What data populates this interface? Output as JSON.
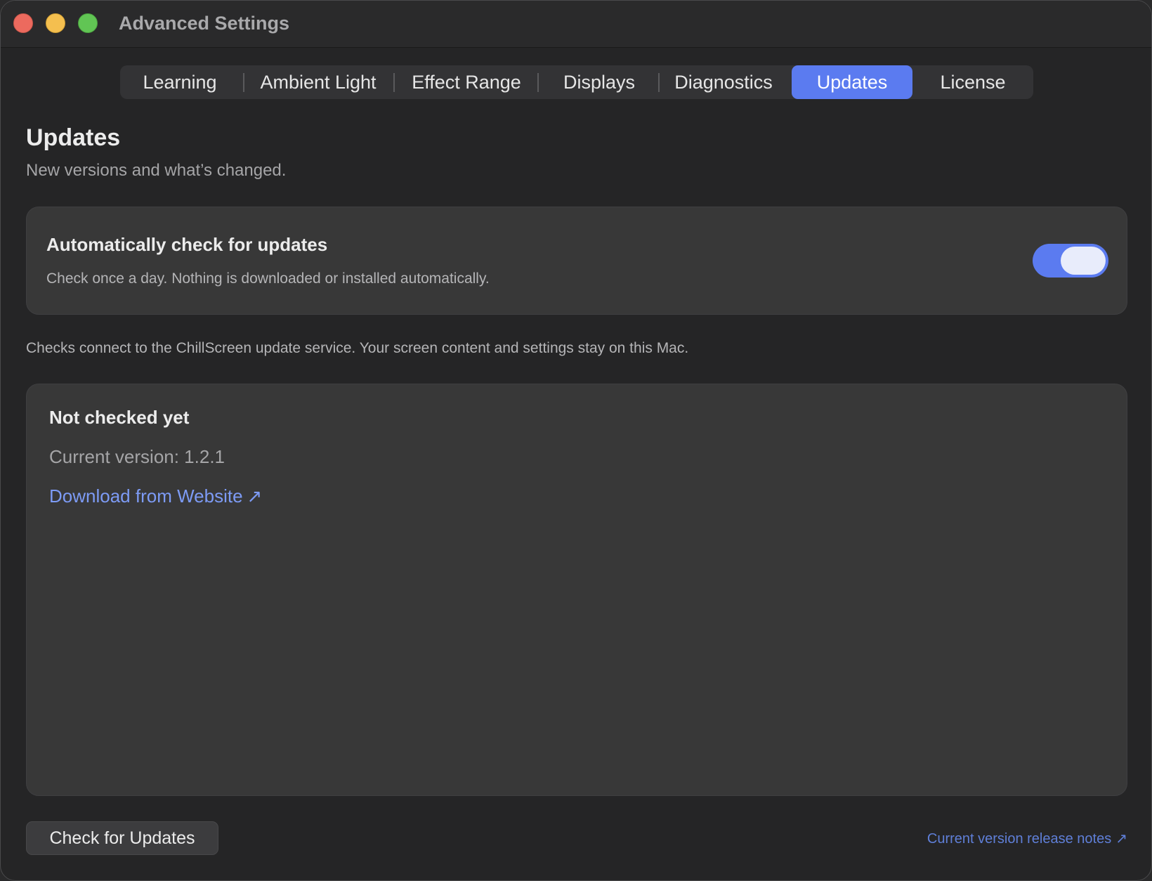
{
  "window": {
    "title": "Advanced Settings"
  },
  "tabs": [
    {
      "label": "Learning",
      "active": false
    },
    {
      "label": "Ambient Light",
      "active": false
    },
    {
      "label": "Effect Range",
      "active": false
    },
    {
      "label": "Displays",
      "active": false
    },
    {
      "label": "Diagnostics",
      "active": false
    },
    {
      "label": "Updates",
      "active": true
    },
    {
      "label": "License",
      "active": false
    }
  ],
  "page": {
    "title": "Updates",
    "subtitle": "New versions and what’s changed."
  },
  "auto_check": {
    "title": "Automatically check for updates",
    "description": "Check once a day. Nothing is downloaded or installed automatically.",
    "enabled": true
  },
  "privacy_note": "Checks connect to the ChillScreen update service. Your screen content and settings stay on this Mac.",
  "status_card": {
    "status": "Not checked yet",
    "current_version": "Current version: 1.2.1",
    "download_link": "Download from Website",
    "download_icon": "arrow-up-right-icon"
  },
  "footer": {
    "check_button": "Check for Updates",
    "release_notes_link": "Current version release notes",
    "release_notes_icon": "arrow-up-right-icon"
  },
  "colors": {
    "accent": "#5b7bf0",
    "link": "#7d9bf5",
    "close": "#ec6a5e",
    "minimize": "#f4bf4f",
    "maximize": "#61c554"
  }
}
